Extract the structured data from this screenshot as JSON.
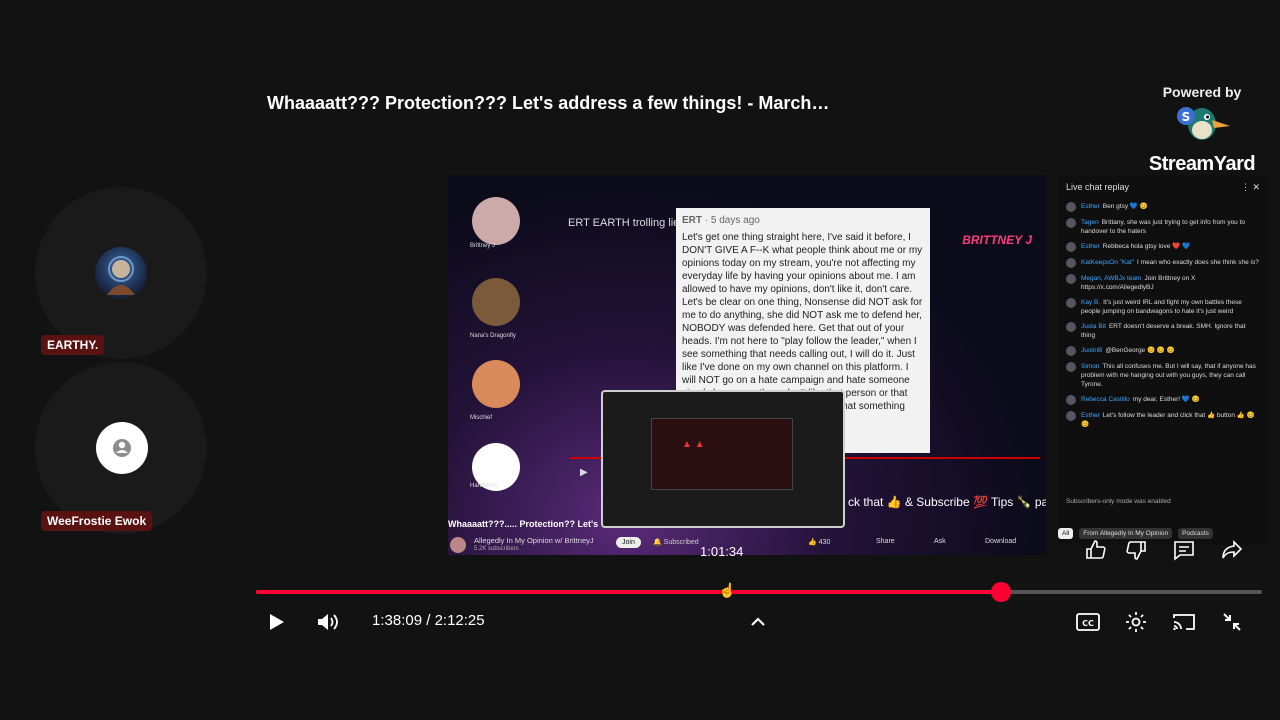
{
  "video": {
    "title": "Whaaaatt??? Protection??? Let's address a few things! - March…",
    "current_time": "1:38:09",
    "duration": "2:12:25",
    "time_separator": "/",
    "hover_time": "1:01:34",
    "progress_fraction": 0.741,
    "hover_fraction": 0.466
  },
  "branding": {
    "powered_by": "Powered by",
    "name": "StreamYard"
  },
  "participants": [
    {
      "name": "EARTHY."
    },
    {
      "name": "WeeFrostie Ewok"
    }
  ],
  "stage": {
    "side_labels": [
      "Brittney J",
      "Nana's Dragonfly",
      "Mischief",
      "HardMess"
    ],
    "header": "ERT EARTH trolling lies manipulation and who she supports",
    "brand_text": "BRITTNEY J",
    "popup": {
      "author": "ERT",
      "age": "5 days ago",
      "body": "Let's get one thing straight here, I've said it before, I DON'T GIVE A F--K what people think about me or my opinions today on my stream, you're not affecting my everyday life by having your opinions about me. I am allowed to have my opinions, don't like it, don't care. Let's be clear on one thing, Nonsense did NOT ask for me to do anything, she did NOT ask me to defend her, NOBODY was defended here. Get that out of your heads. I'm not here to \"play follow the leader,\" when I see something that needs calling out, I will do it. Just like I've done on my own channel on this platform. I will NOT go on a hate campaign and hate someone simply because others don't like that person or that person for assistance, audio things that something stalker-ish Give me a"
    },
    "ticker": "ck that 👍 & Subscribe 💯 Tips 🍾 pa",
    "video_title_line": "Whaaaatt???..... Protection?? Let's",
    "channel": "Allegedly In My Opinion w/ BrittneyJ",
    "subscribers": "5.2K subscribers",
    "join": "Join",
    "subscribed": "Subscribed",
    "likes": "430",
    "share": "Share",
    "ask": "Ask",
    "download": "Download"
  },
  "chat": {
    "header": "Live chat replay",
    "messages": [
      {
        "author": "Esther",
        "text": "Ben gtsy 💙 😊"
      },
      {
        "author": "Tagen",
        "text": "Brittany, she was just trying to get info from you to handover to the haters"
      },
      {
        "author": "Esther",
        "text": "Rebbeca hola gtsy love ❤️ 💙"
      },
      {
        "author": "KatKeepsOn \"Kat\"",
        "text": "I mean who exactly does she think she is?"
      },
      {
        "author": "Megan, AWBJx team",
        "text": "Join Brittney on X https://x.com/AllegedlyBJ"
      },
      {
        "author": "Kay B.",
        "text": "It's just weird IRL and fight my own battles these people jumping on bandwagons to hate it's just weird"
      },
      {
        "author": "Justa Bit",
        "text": "ERT doesn't deserve a break. SMH. Ignore that thing"
      },
      {
        "author": "JustinB",
        "text": "@BenGeorge 😊 😊 😊"
      },
      {
        "author": "Simon",
        "text": "This all confuses me. But I will say, that if anyone has problem with me hanging out with you guys, they can call Tyrone."
      },
      {
        "author": "Rebecca Castillo",
        "text": "my dear, Esther! 💙 😊"
      },
      {
        "author": "Esther",
        "text": "Let's follow the leader and click that 👍 button 👍 😊 😊"
      }
    ],
    "footer": "Subscribers-only mode was enabled",
    "chips": [
      "All",
      "From Allegedly In My Opinion",
      "Podcasts"
    ]
  },
  "colors": {
    "accent": "#ff0033",
    "tag_bg": "#5a1111",
    "background": "#121212"
  },
  "icons": [
    "play-icon",
    "volume-icon",
    "chevron-up-icon",
    "captions-icon",
    "settings-icon",
    "cast-icon",
    "exit-fullscreen-icon",
    "thumbs-up-icon",
    "thumbs-down-icon",
    "comment-icon",
    "share-icon"
  ]
}
